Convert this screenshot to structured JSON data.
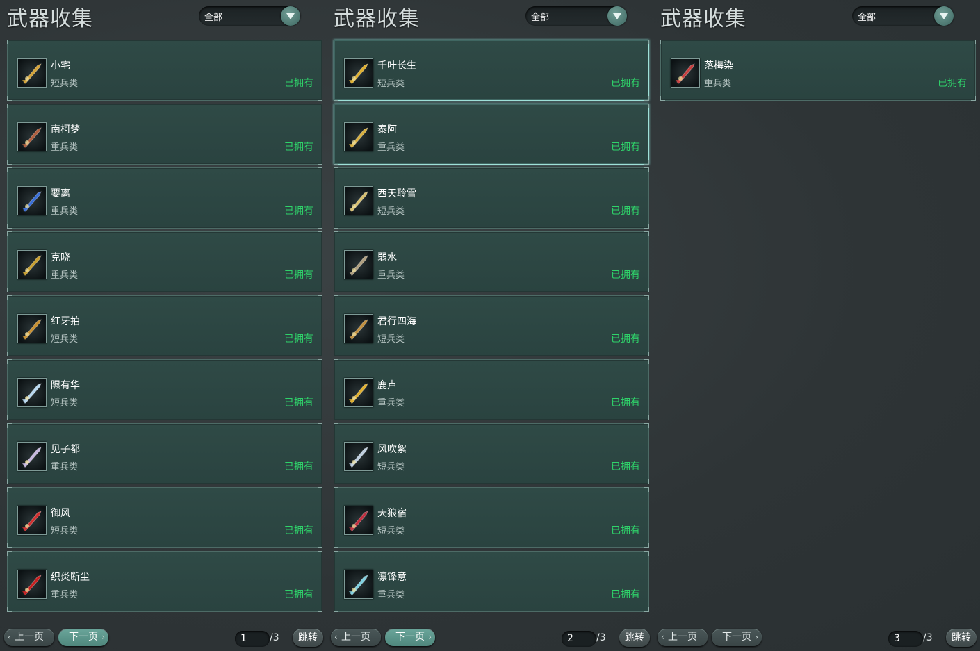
{
  "panels": [
    {
      "title": "武器收集",
      "filter": "全部",
      "items": [
        {
          "name": "小宅",
          "type": "短兵类",
          "status": "已拥有",
          "icon": "axe-icon",
          "color": "#d4a43a"
        },
        {
          "name": "南柯梦",
          "type": "重兵类",
          "status": "已拥有",
          "icon": "hammer-icon",
          "color": "#b06040"
        },
        {
          "name": "要离",
          "type": "重兵类",
          "status": "已拥有",
          "icon": "blade-icon",
          "color": "#3a6fd8"
        },
        {
          "name": "克晓",
          "type": "重兵类",
          "status": "已拥有",
          "icon": "sword-icon",
          "color": "#c8a030"
        },
        {
          "name": "红牙拍",
          "type": "短兵类",
          "status": "已拥有",
          "icon": "dagger-icon",
          "color": "#c89030"
        },
        {
          "name": "隰有华",
          "type": "短兵类",
          "status": "已拥有",
          "icon": "crystal-icon",
          "color": "#b8d8f0"
        },
        {
          "name": "见子都",
          "type": "重兵类",
          "status": "已拥有",
          "icon": "crystal-blade-icon",
          "color": "#c8b8e0"
        },
        {
          "name": "御风",
          "type": "短兵类",
          "status": "已拥有",
          "icon": "red-blade-icon",
          "color": "#d03030"
        },
        {
          "name": "织炎断尘",
          "type": "重兵类",
          "status": "已拥有",
          "icon": "flame-icon",
          "color": "#c82020"
        }
      ],
      "pager": {
        "prev": "上一页",
        "next": "下一页",
        "page": "1",
        "total": "/3",
        "jump": "跳转",
        "active": "next"
      }
    },
    {
      "title": "武器收集",
      "filter": "全部",
      "items": [
        {
          "name": "千叶长生",
          "type": "短兵类",
          "status": "已拥有",
          "icon": "staff-icon",
          "color": "#e0b030",
          "selected": true
        },
        {
          "name": "泰阿",
          "type": "重兵类",
          "status": "已拥有",
          "icon": "dark-blade-icon",
          "color": "#d8b040",
          "selected": true
        },
        {
          "name": "西天聆雪",
          "type": "短兵类",
          "status": "已拥有",
          "icon": "trident-icon",
          "color": "#d8c070"
        },
        {
          "name": "弱水",
          "type": "重兵类",
          "status": "已拥有",
          "icon": "spear-icon",
          "color": "#b0a080"
        },
        {
          "name": "君行四海",
          "type": "短兵类",
          "status": "已拥有",
          "icon": "dagger-icon",
          "color": "#c09040"
        },
        {
          "name": "鹿卢",
          "type": "重兵类",
          "status": "已拥有",
          "icon": "gold-sword-icon",
          "color": "#e0b030"
        },
        {
          "name": "风吹絮",
          "type": "短兵类",
          "status": "已拥有",
          "icon": "fan-blade-icon",
          "color": "#c0d0e0"
        },
        {
          "name": "天狼宿",
          "type": "短兵类",
          "status": "已拥有",
          "icon": "wolf-blade-icon",
          "color": "#c03040"
        },
        {
          "name": "凛锋意",
          "type": "重兵类",
          "status": "已拥有",
          "icon": "ice-blade-icon",
          "color": "#80d0e0"
        }
      ],
      "pager": {
        "prev": "上一页",
        "next": "下一页",
        "page": "2",
        "total": "/3",
        "jump": "跳转",
        "active": "next"
      }
    },
    {
      "title": "武器收集",
      "filter": "全部",
      "items": [
        {
          "name": "落梅染",
          "type": "重兵类",
          "status": "已拥有",
          "icon": "plum-blade-icon",
          "color": "#c84040"
        }
      ],
      "pager": {
        "prev": "上一页",
        "next": "下一页",
        "page": "3",
        "total": "/3",
        "jump": "跳转",
        "active": "none"
      }
    }
  ]
}
